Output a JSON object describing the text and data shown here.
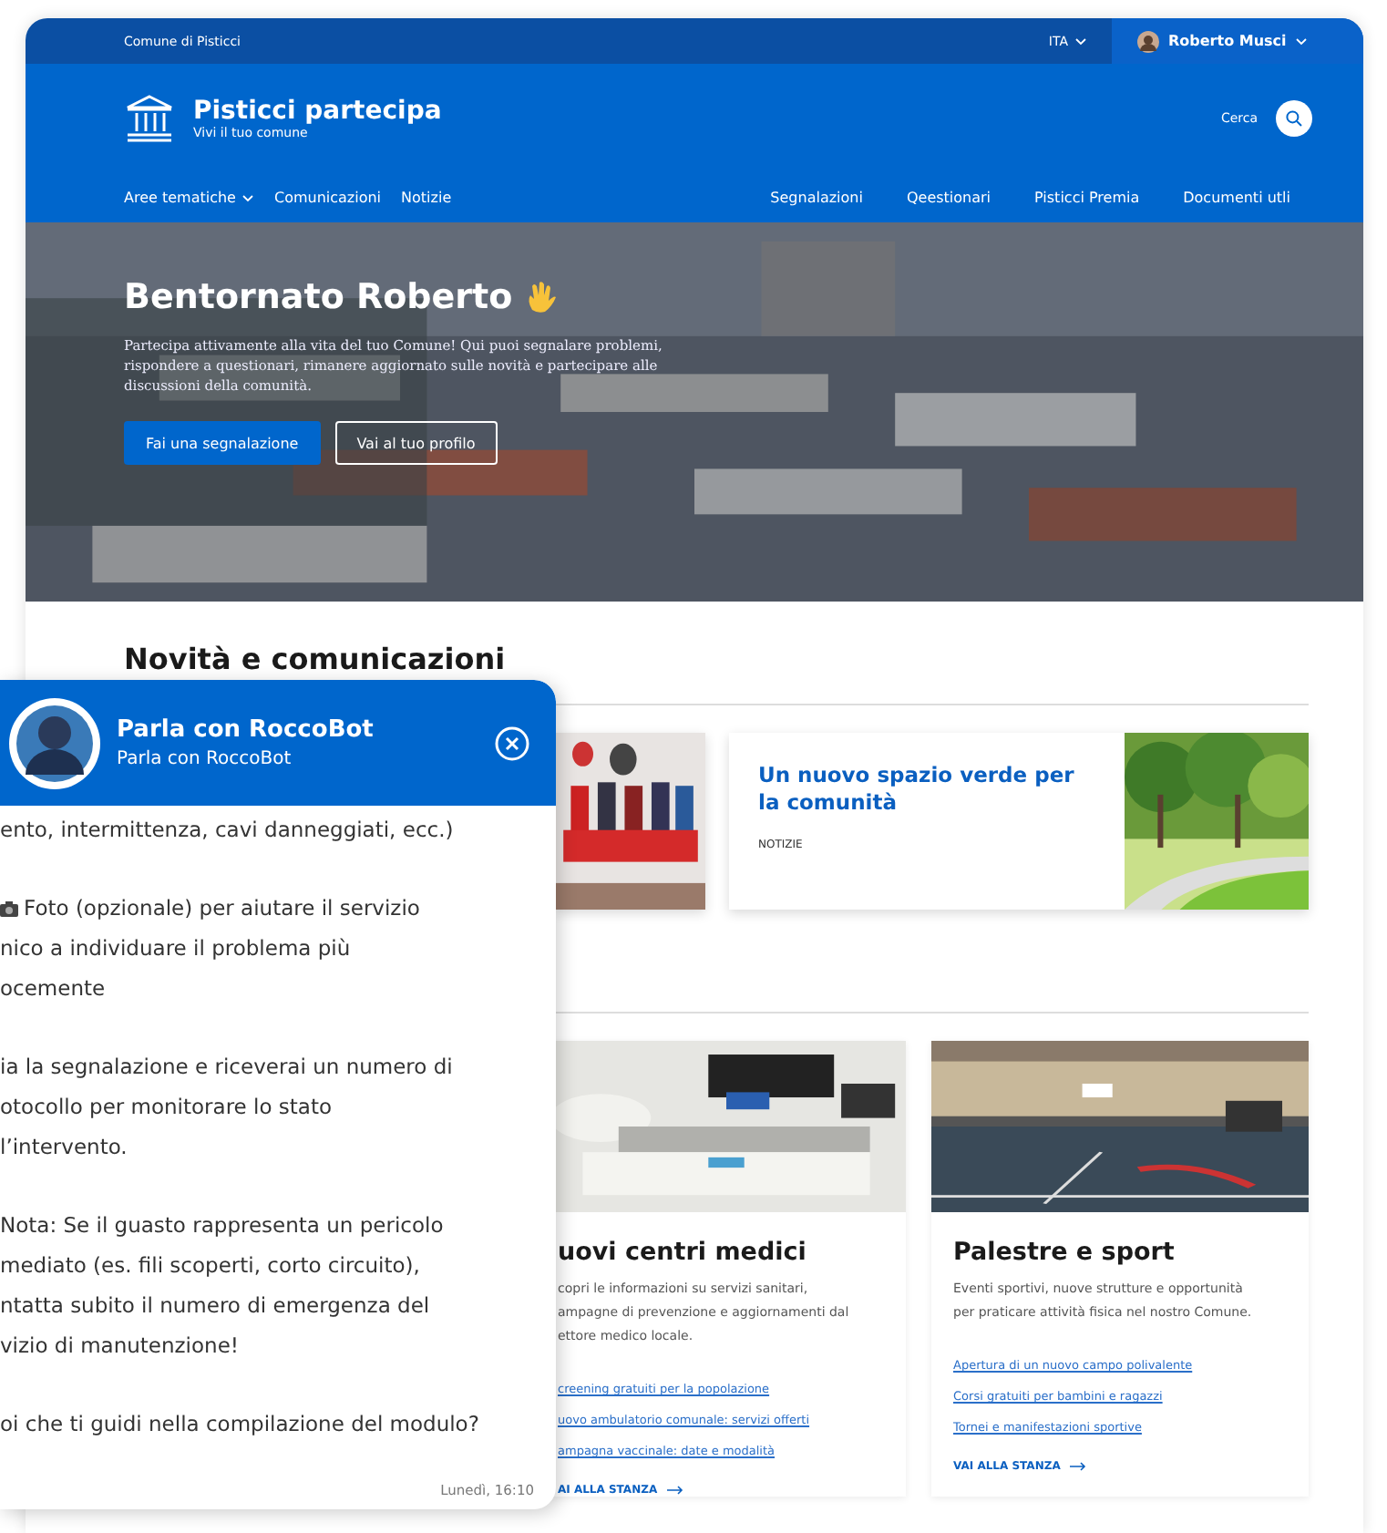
{
  "top_bar": {
    "site": "Comune di Pisticci",
    "language": "ITA",
    "user": "Roberto Musci"
  },
  "header": {
    "title": "Pisticci partecipa",
    "subtitle": "Vivi il tuo comune",
    "search": "Cerca"
  },
  "nav": {
    "left": [
      {
        "label": "Aree tematiche",
        "dropdown": true
      },
      {
        "label": "Comunicazioni",
        "dropdown": false
      },
      {
        "label": "Notizie",
        "dropdown": false
      }
    ],
    "right": [
      {
        "label": "Segnalazioni"
      },
      {
        "label": "Qeestionari"
      },
      {
        "label": "Pisticci Premia"
      },
      {
        "label": "Documenti utli"
      }
    ]
  },
  "hero": {
    "title": "Bentornato Roberto",
    "text": "Partecipa attivamente alla vita del tuo Comune! Qui puoi segnalare problemi, rispondere a questionari, rimanere aggiornato sulle novità e partecipare alle discussioni della comunità.",
    "buttons": [
      {
        "label": "Fai una segnalazione",
        "kind": "primary"
      },
      {
        "label": "Vai al tuo profilo",
        "kind": "outline"
      }
    ]
  },
  "news": {
    "title": "Novità e comunicazioni",
    "cards": [
      {
        "kind": "picture"
      },
      {
        "title": "Un nuovo spazio verde per la comunità",
        "tag": "NOTIZIE"
      }
    ]
  },
  "rooms": [
    {
      "title": "uovi centri medici",
      "text": [
        "copri le informazioni su servizi sanitari,",
        "ampagne di prevenzione e aggiornamenti dal",
        "ettore medico locale."
      ],
      "links": [
        "creening gratuiti per la popolazione",
        "uovo ambulatorio comunale: servizi offerti",
        "ampagna vaccinale: date e modalità"
      ],
      "cta": "AI ALLA STANZA"
    },
    {
      "title": "Palestre e sport",
      "text": [
        "Eventi sportivi, nuove strutture e opportunità",
        "per praticare attività fisica nel nostro Comune."
      ],
      "links": [
        "Apertura di un nuovo campo polivalente",
        "Corsi gratuiti per bambini e ragazzi",
        "Tornei e manifestazioni sportive"
      ],
      "cta": "VAI ALLA STANZA"
    }
  ],
  "chat": {
    "title": "Parla con RoccoBot",
    "subtitle": "Parla con RoccoBot",
    "paragraphs": [
      {
        "icon": false,
        "lines": [
          "ento, intermittenza, cavi danneggiati, ecc.)"
        ]
      },
      {
        "icon": true,
        "lines": [
          "Foto (opzionale) per aiutare il servizio",
          "nico a individuare il problema più",
          "ocemente"
        ]
      },
      {
        "icon": false,
        "lines": [
          "ia la segnalazione e riceverai un numero di",
          "otocollo per monitorare lo stato",
          "l’intervento."
        ]
      },
      {
        "icon": false,
        "lines": [
          "Nota: Se il guasto rappresenta un pericolo",
          "mediato (es. fili scoperti, corto circuito),",
          "ntatta subito il numero di emergenza del",
          "vizio di manutenzione!"
        ]
      },
      {
        "icon": false,
        "lines": [
          "oi che ti guidi nella compilazione del modulo?"
        ]
      }
    ],
    "time": "Lunedì, 16:10"
  }
}
